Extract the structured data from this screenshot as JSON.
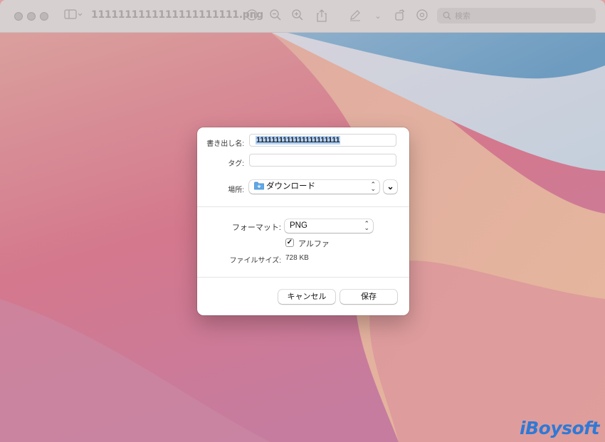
{
  "window": {
    "title": "1111111111111111111111.png",
    "search_placeholder": "検索"
  },
  "dialog": {
    "export_as_label": "書き出し名:",
    "export_as_value": "1111111111111111111111",
    "tags_label": "タグ:",
    "tags_value": "",
    "location_label": "場所:",
    "location_value": "ダウンロード",
    "format_label": "フォーマット:",
    "format_value": "PNG",
    "alpha_label": "アルファ",
    "alpha_checked": true,
    "filesize_label": "ファイルサイズ:",
    "filesize_value": "728 KB",
    "cancel_label": "キャンセル",
    "save_label": "保存"
  },
  "watermark": "iBoysoft",
  "colors": {
    "accent": "#2f79d6",
    "folder": "#5fa8e8"
  }
}
